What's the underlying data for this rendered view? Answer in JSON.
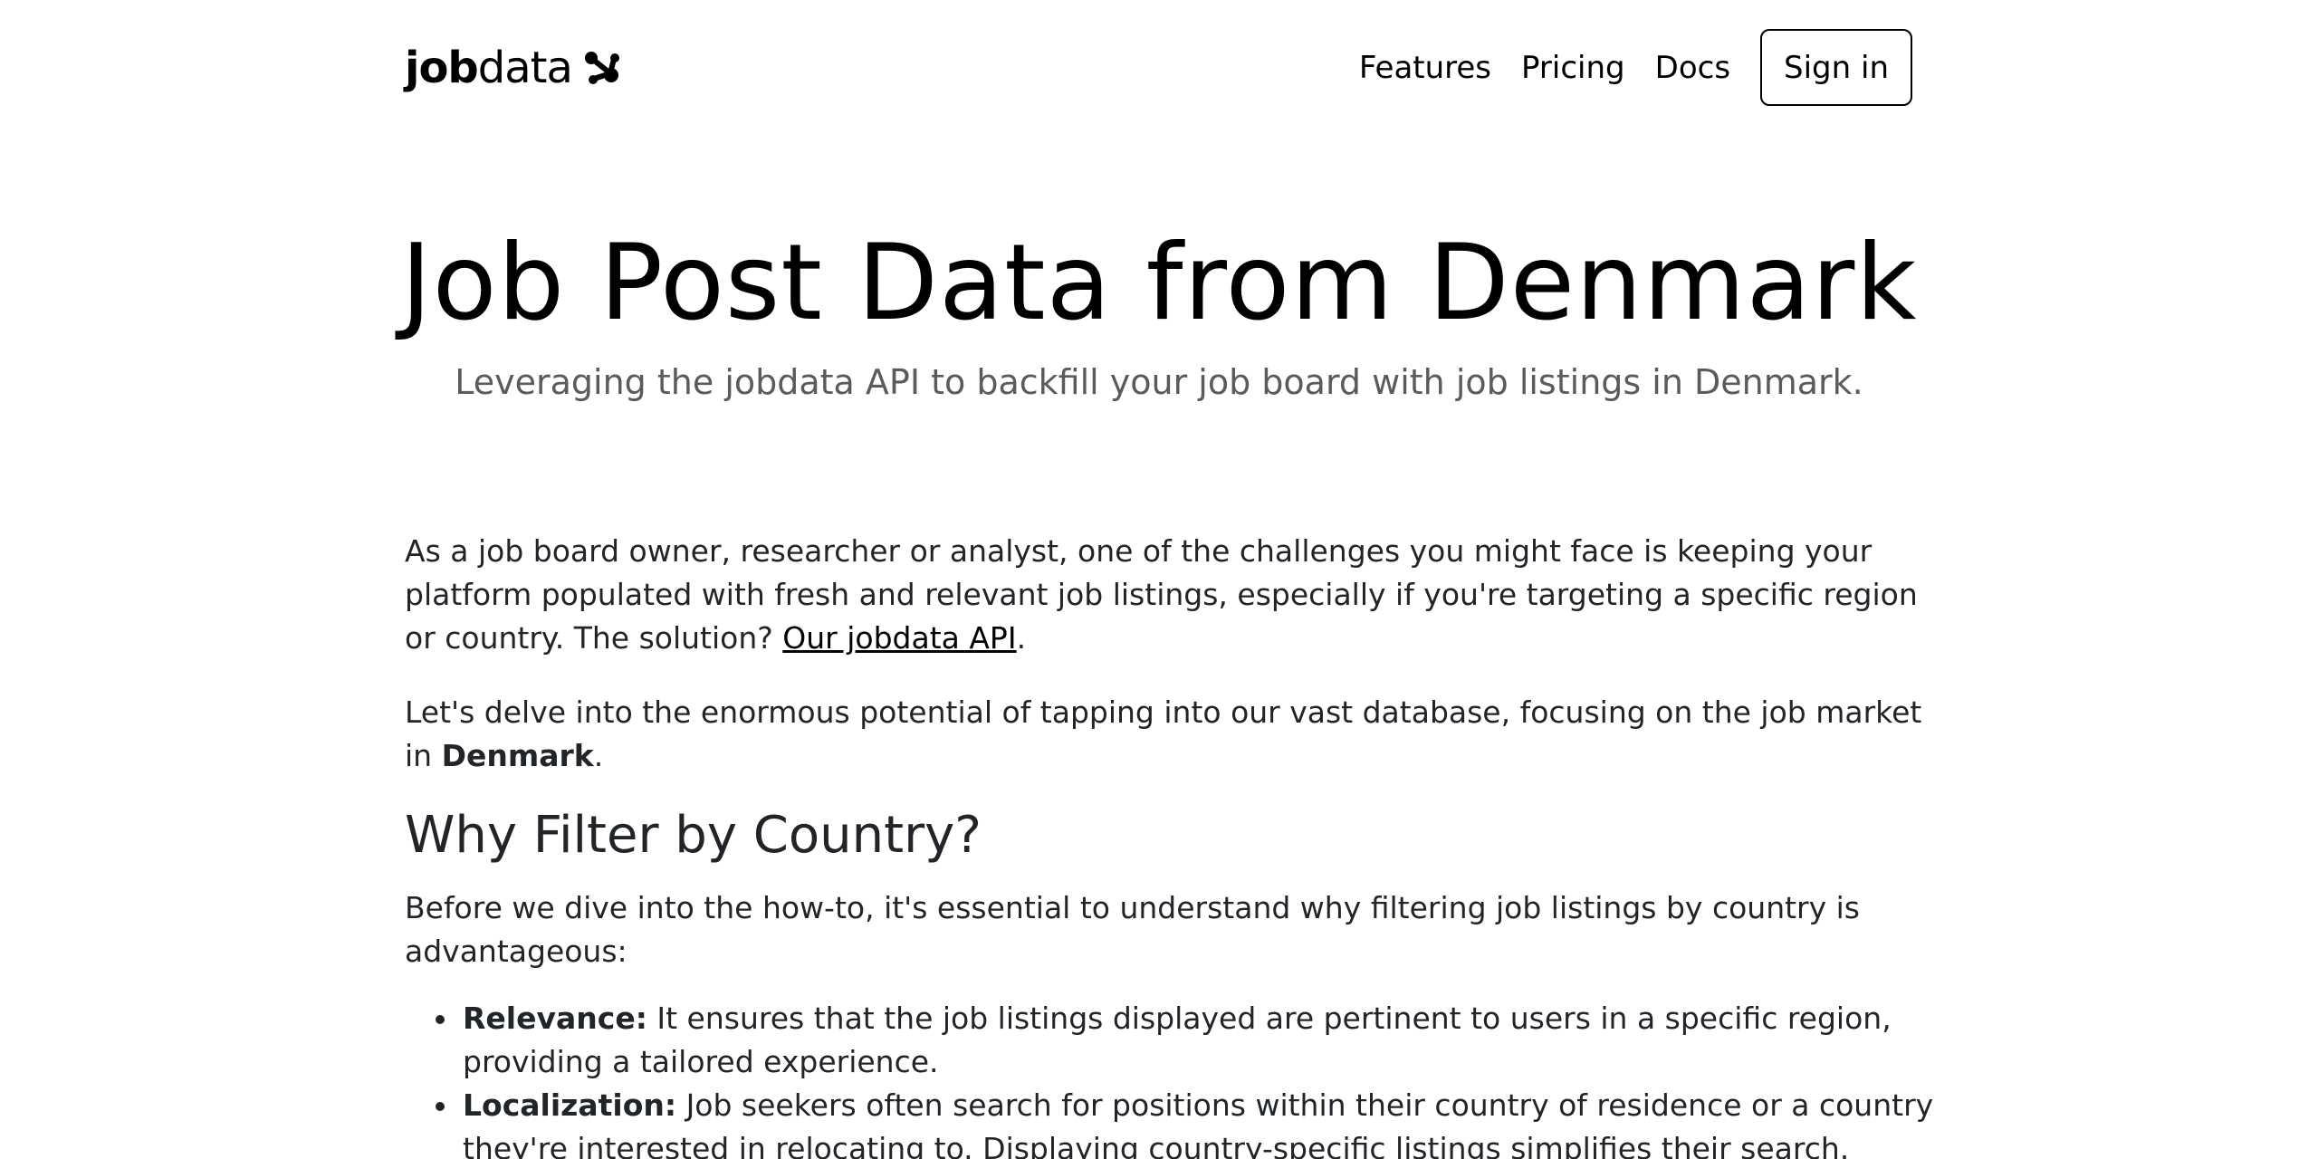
{
  "header": {
    "logo_bold": "job",
    "logo_regular": "data",
    "logo_icon": "molecule-logo-icon",
    "nav": [
      {
        "label": "Features"
      },
      {
        "label": "Pricing"
      },
      {
        "label": "Docs"
      }
    ],
    "signin_label": "Sign in"
  },
  "hero": {
    "title": "Job Post Data from Denmark",
    "subtitle": "Leveraging the jobdata API to backfill your job board with job listings in Denmark."
  },
  "article": {
    "p1_text": "As a job board owner, researcher or analyst, one of the challenges you might face is keeping your platform populated with fresh and relevant job listings, especially if you're targeting a specific region or country. The solution? ",
    "p1_link": "Our jobdata API",
    "p1_end": ".",
    "p2_text": "Let's delve into the enormous potential of tapping into our vast database, focusing on the job market in ",
    "p2_bold": "Denmark",
    "p2_end": ".",
    "h2": "Why Filter by Country?",
    "p3_text": "Before we dive into the how-to, it's essential to understand why filtering job listings by country is advantageous:",
    "bullets": [
      {
        "term": "Relevance:",
        "text": " It ensures that the job listings displayed are pertinent to users in a specific region, providing a tailored experience."
      },
      {
        "term": "Localization:",
        "text": " Job seekers often search for positions within their country of residence or a country they're interested in relocating to. Displaying country-specific listings simplifies their search."
      }
    ]
  },
  "colors": {
    "text": "#212529",
    "subtitle": "#595c5f",
    "heading": "#000000",
    "background": "#ffffff"
  }
}
